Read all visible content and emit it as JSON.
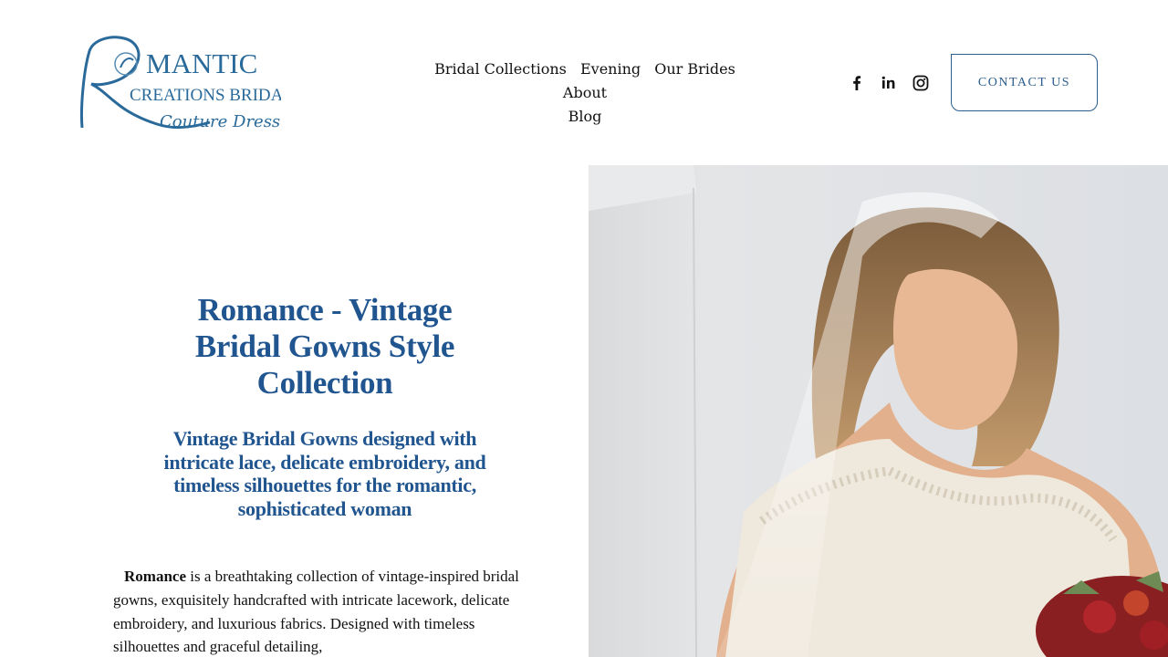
{
  "logo": {
    "line1": "MANTIC",
    "line2": "CREATIONS BRIDAL",
    "line3": "Couture Dresses",
    "initial": "R"
  },
  "nav": {
    "items": [
      {
        "label": "Bridal Collections"
      },
      {
        "label": "Evening"
      },
      {
        "label": "Our Brides"
      },
      {
        "label": "About"
      },
      {
        "label": "Blog"
      }
    ]
  },
  "social": {
    "facebook": "f",
    "linkedin": "in"
  },
  "contact": {
    "label": "CONTACT US"
  },
  "hero": {
    "title": "Romance - Vintage Bridal Gowns Style Collection",
    "subtitle": "Vintage Bridal Gowns designed with intricate lace, delicate embroidery, and timeless silhouettes for the romantic, sophisticated woman",
    "body_bold": "Romance",
    "body_rest": " is a breathtaking collection of vintage-inspired bridal gowns, exquisitely handcrafted with intricate lacework, delicate embroidery, and luxurious fabrics. Designed with timeless silhouettes and graceful detailing,"
  },
  "colors": {
    "brand_blue": "#20558f",
    "logo_blue": "#2a6a9a"
  },
  "icons": {
    "facebook": "facebook-icon",
    "linkedin": "linkedin-icon",
    "instagram": "instagram-icon"
  }
}
